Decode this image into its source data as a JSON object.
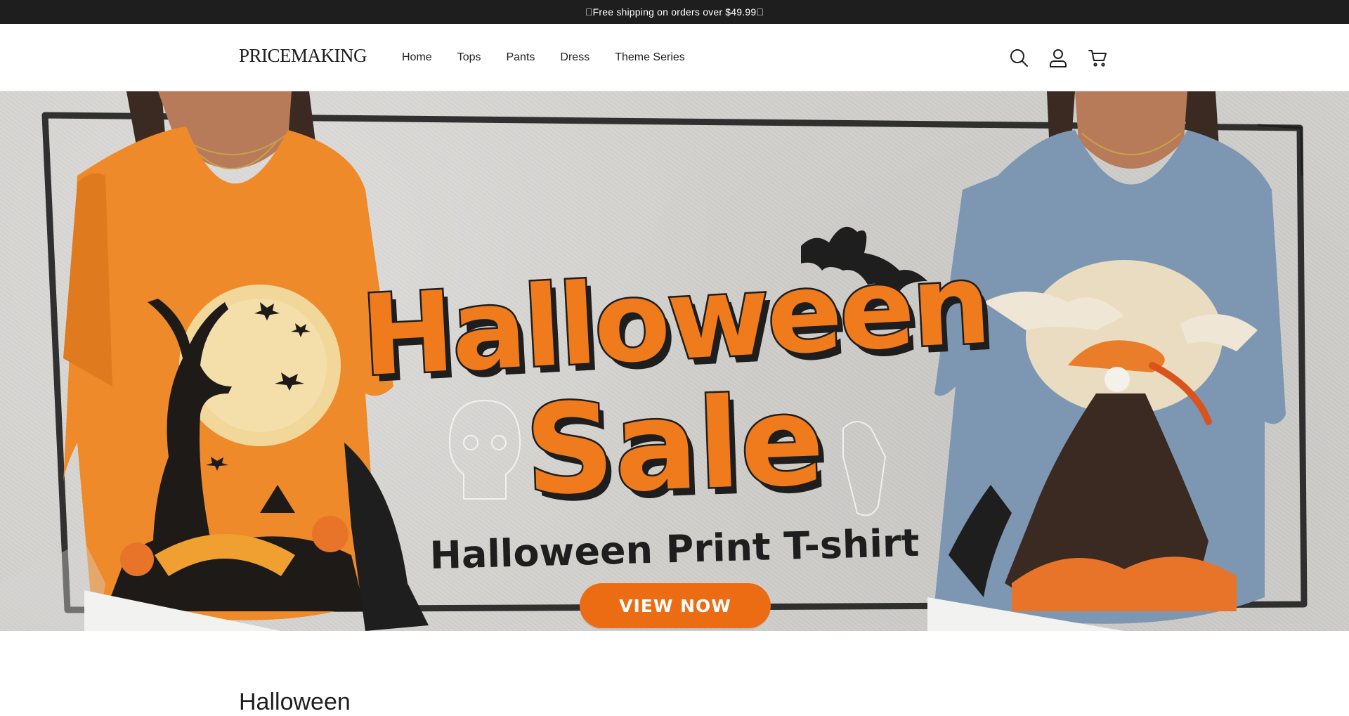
{
  "announcement": {
    "text": "Free shipping on orders over $49.99"
  },
  "header": {
    "logo": "PRICEMAKING",
    "nav": [
      "Home",
      "Tops",
      "Pants",
      "Dress",
      "Theme Series"
    ],
    "icons": [
      "search-icon",
      "account-icon",
      "cart-icon"
    ]
  },
  "hero": {
    "headline_line1": "Halloween",
    "headline_line2": "Sale",
    "subheadline": "Halloween Print T-shirt",
    "cta_label": "VIEW NOW",
    "colors": {
      "accent": "#ec6c13",
      "background": "#d2d1ce",
      "ink": "#1e1e1e"
    }
  },
  "section": {
    "title": "Halloween"
  }
}
